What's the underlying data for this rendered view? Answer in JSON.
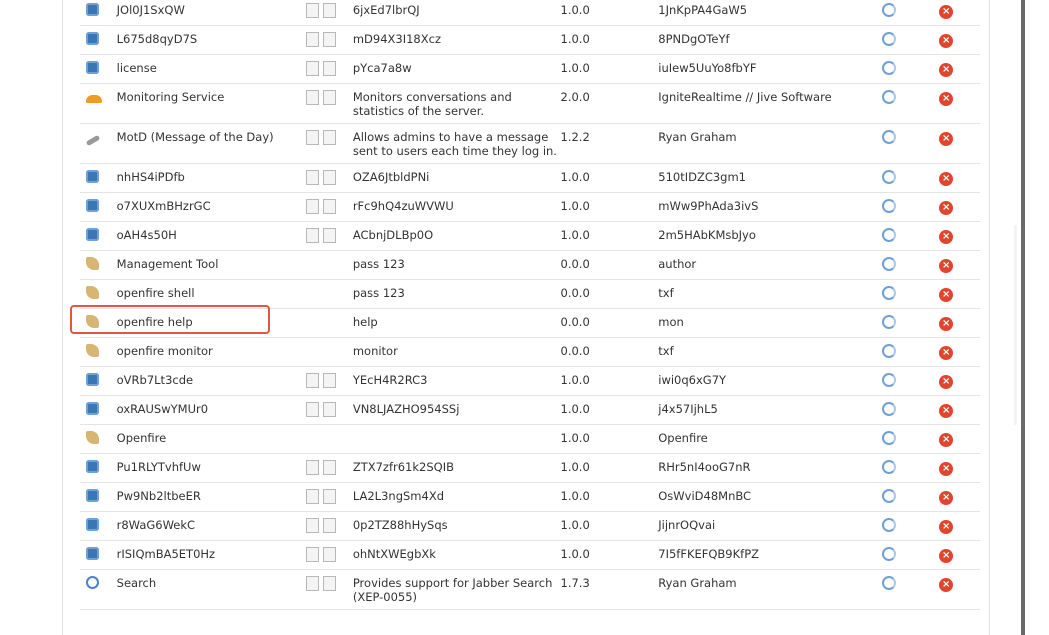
{
  "plugins": [
    {
      "icon": "plugin-icon",
      "name": "JOl0J1SxQW",
      "docs": true,
      "description": "6jxEd7lbrQJ",
      "version": "1.0.0",
      "author": "1JnKpPA4GaW5"
    },
    {
      "icon": "plugin-icon",
      "name": "L675d8qyD7S",
      "docs": true,
      "description": "mD94X3I18Xcz",
      "version": "1.0.0",
      "author": "8PNDgOTeYf"
    },
    {
      "icon": "plugin-icon",
      "name": "license",
      "docs": true,
      "description": "pYca7a8w",
      "version": "1.0.0",
      "author": "iuIew5UuYo8fbYF"
    },
    {
      "icon": "monitoring-icon",
      "name": "Monitoring Service",
      "docs": true,
      "description": "Monitors conversations and statistics of the server.",
      "version": "2.0.0",
      "author": "IgniteRealtime // Jive Software"
    },
    {
      "icon": "motd-icon",
      "name": "MotD (Message of the Day)",
      "docs": true,
      "description": "Allows admins to have a message sent to users each time they log in.",
      "version": "1.2.2",
      "author": "Ryan Graham"
    },
    {
      "icon": "plugin-icon",
      "name": "nhHS4iPDfb",
      "docs": true,
      "description": "OZA6JtbldPNi",
      "version": "1.0.0",
      "author": "510tIDZC3gm1"
    },
    {
      "icon": "plugin-icon",
      "name": "o7XUXmBHzrGC",
      "docs": true,
      "description": "rFc9hQ4zuWVWU",
      "version": "1.0.0",
      "author": "mWw9PhAda3ivS"
    },
    {
      "icon": "plugin-icon",
      "name": "oAH4s50H",
      "docs": true,
      "description": "ACbnjDLBp0O",
      "version": "1.0.0",
      "author": "2m5HAbKMsbJyo"
    },
    {
      "icon": "tool-icon",
      "name": "Management Tool",
      "docs": false,
      "description": "pass 123",
      "version": "0.0.0",
      "author": "author"
    },
    {
      "icon": "tool-icon",
      "name": "openfire shell",
      "docs": false,
      "description": "pass 123",
      "version": "0.0.0",
      "author": "txf"
    },
    {
      "icon": "tool-icon",
      "name": "openfire help",
      "docs": false,
      "description": "help",
      "version": "0.0.0",
      "author": "mon"
    },
    {
      "icon": "tool-icon",
      "name": "openfire monitor",
      "docs": false,
      "description": "monitor",
      "version": "0.0.0",
      "author": "txf"
    },
    {
      "icon": "plugin-icon",
      "name": "oVRb7Lt3cde",
      "docs": true,
      "description": "YEcH4R2RC3",
      "version": "1.0.0",
      "author": "iwi0q6xG7Y"
    },
    {
      "icon": "plugin-icon",
      "name": "oxRAUSwYMUr0",
      "docs": true,
      "description": "VN8LJAZHO954SSj",
      "version": "1.0.0",
      "author": "j4x57IjhL5"
    },
    {
      "icon": "tool-icon",
      "name": "Openfire",
      "docs": false,
      "description": "",
      "version": "1.0.0",
      "author": "Openfire"
    },
    {
      "icon": "plugin-icon",
      "name": "Pu1RLYTvhfUw",
      "docs": true,
      "description": "ZTX7zfr61k2SQIB",
      "version": "1.0.0",
      "author": "RHr5nI4ooG7nR"
    },
    {
      "icon": "plugin-icon",
      "name": "Pw9Nb2ltbeER",
      "docs": true,
      "description": "LA2L3ngSm4Xd",
      "version": "1.0.0",
      "author": "OsWviD48MnBC"
    },
    {
      "icon": "plugin-icon",
      "name": "r8WaG6WekC",
      "docs": true,
      "description": "0p2TZ88hHySqs",
      "version": "1.0.0",
      "author": "JijnrOQvai"
    },
    {
      "icon": "plugin-icon",
      "name": "rISIQmBA5ET0Hz",
      "docs": true,
      "description": "ohNtXWEgbXk",
      "version": "1.0.0",
      "author": "7I5fFKEFQB9KfPZ"
    },
    {
      "icon": "search-icon",
      "name": "Search",
      "docs": true,
      "description": "Provides support for Jabber Search (XEP-0055)",
      "version": "1.7.3",
      "author": "Ryan Graham"
    }
  ],
  "colors": {
    "highlight": "#e2573d",
    "delete": "#e0452d",
    "update": "#6ea0d8"
  }
}
